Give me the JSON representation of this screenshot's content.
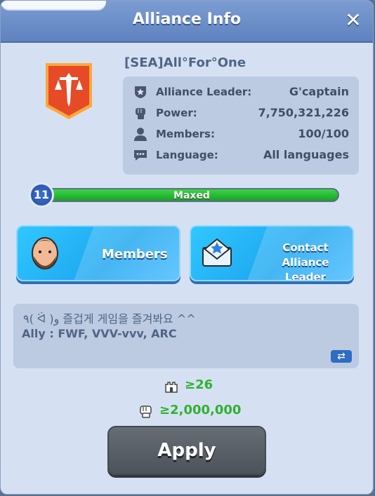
{
  "header": {
    "title": "Alliance Info",
    "close_icon": "close-icon"
  },
  "alliance": {
    "name": "[SEA]All°For°One",
    "emblem": "banner-sword-icon",
    "info": [
      {
        "icon": "shield-star-icon",
        "label": "Alliance Leader:",
        "value": "G'captain"
      },
      {
        "icon": "fist-icon",
        "label": "Power:",
        "value": "7,750,321,226"
      },
      {
        "icon": "person-icon",
        "label": "Members:",
        "value": "100/100"
      },
      {
        "icon": "speech-bubble-icon",
        "label": "Language:",
        "value": "All languages"
      }
    ]
  },
  "progress": {
    "level": "11",
    "text": "Maxed",
    "value": 1.0
  },
  "buttons": {
    "members": {
      "label": "Members",
      "icon": "avatar-icon"
    },
    "contact": {
      "label_line1": "Contact Alliance",
      "label_line2": "Leader",
      "icon": "mail-icon"
    }
  },
  "description": {
    "line1": "٩( ᐛ )و 즐겁게 게임을 즐겨봐요 ^^",
    "line2": "Ally : FWF, VVV-vvv, ARC",
    "translate_icon": "translate-icon"
  },
  "requirements": [
    {
      "icon": "castle-icon",
      "text": "≥26"
    },
    {
      "icon": "fist-icon",
      "text": "≥2,000,000"
    }
  ],
  "apply_label": "Apply",
  "colors": {
    "accent_green": "#2fb12f",
    "button_blue": "#1ea7f0"
  }
}
